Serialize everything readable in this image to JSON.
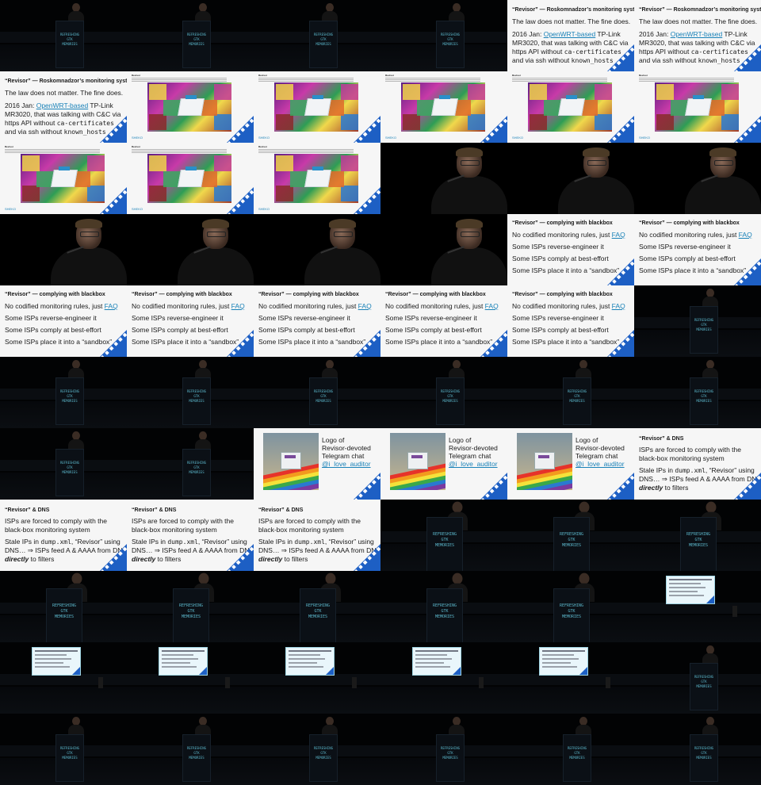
{
  "podium": {
    "line1": "REFRESHING",
    "line2": "GTK",
    "line3": "MEMORIES"
  },
  "slides": {
    "roskomnadzor": {
      "title": "“Revisor” — Roskomnadzor’s monitoring system",
      "line1": "The law does not matter. The fine does.",
      "line2_prefix": "2016 Jan: ",
      "line2_link": "OpenWRT-based",
      "line2_suffix": " TP-Link",
      "line3": "MR3020, that was talking with C&C via",
      "line4_prefix": "https API without ",
      "line4_mono": "ca-certificates",
      "line5_prefix": "and via ssh without ",
      "line5_mono": "known_hosts"
    },
    "blackbox": {
      "title": "“Revisor” — complying with blackbox",
      "line1_prefix": "No codified monitoring rules, just ",
      "line1_link": "FAQ",
      "line2": "Some ISPs reverse-engineer it",
      "line3": "Some ISPs comply at best-effort",
      "line4": "Some ISPs place it into a “sandbox”"
    },
    "meme": {
      "title": "Revisor",
      "footer": "SHEKO"
    },
    "logo": {
      "line1": "Logo of",
      "line2": "Revisor-devoted",
      "line3": "Telegram chat",
      "line4": "@i_love_auditor"
    },
    "dns": {
      "title": "“Revisor” & DNS",
      "line1": "ISPs are forced to comply with the",
      "line2": "black-box monitoring system",
      "line3_prefix": "Stale IPs in ",
      "line3_mono": "dump.xml",
      "line3_suffix": ", “Revisor” using",
      "line4": "DNS… ⇒ ISPs feed A & AAAA from DNS",
      "line5_em": "directly",
      "line5_suffix": " to filters"
    }
  },
  "frames": [
    "stage",
    "stage",
    "stage",
    "stage",
    "sA",
    "sA",
    "sA",
    "sC",
    "sC",
    "sC",
    "sC",
    "sC",
    "sC",
    "sC",
    "sC",
    "closeup",
    "closeup",
    "closeup",
    "closeup",
    "closeup",
    "closeup",
    "closeup",
    "sB",
    "sB",
    "sB",
    "sB",
    "sB",
    "sB",
    "sB",
    "stage",
    "stage",
    "stage",
    "stage",
    "stage",
    "stage",
    "stage",
    "stage",
    "stage",
    "sD",
    "sD",
    "sD",
    "sE",
    "sE",
    "sE",
    "sE",
    "mid",
    "mid",
    "mid",
    "mid",
    "mid",
    "mid",
    "mid",
    "mid",
    "screen",
    "screen",
    "screen",
    "screen",
    "screen",
    "screen",
    "stage",
    "stage",
    "stage",
    "stage",
    "stage",
    "stage",
    "stage"
  ],
  "colors": {
    "link": "#1a82b8",
    "corner": "#1d5fc4",
    "slide_bg": "#f6f6f6"
  }
}
